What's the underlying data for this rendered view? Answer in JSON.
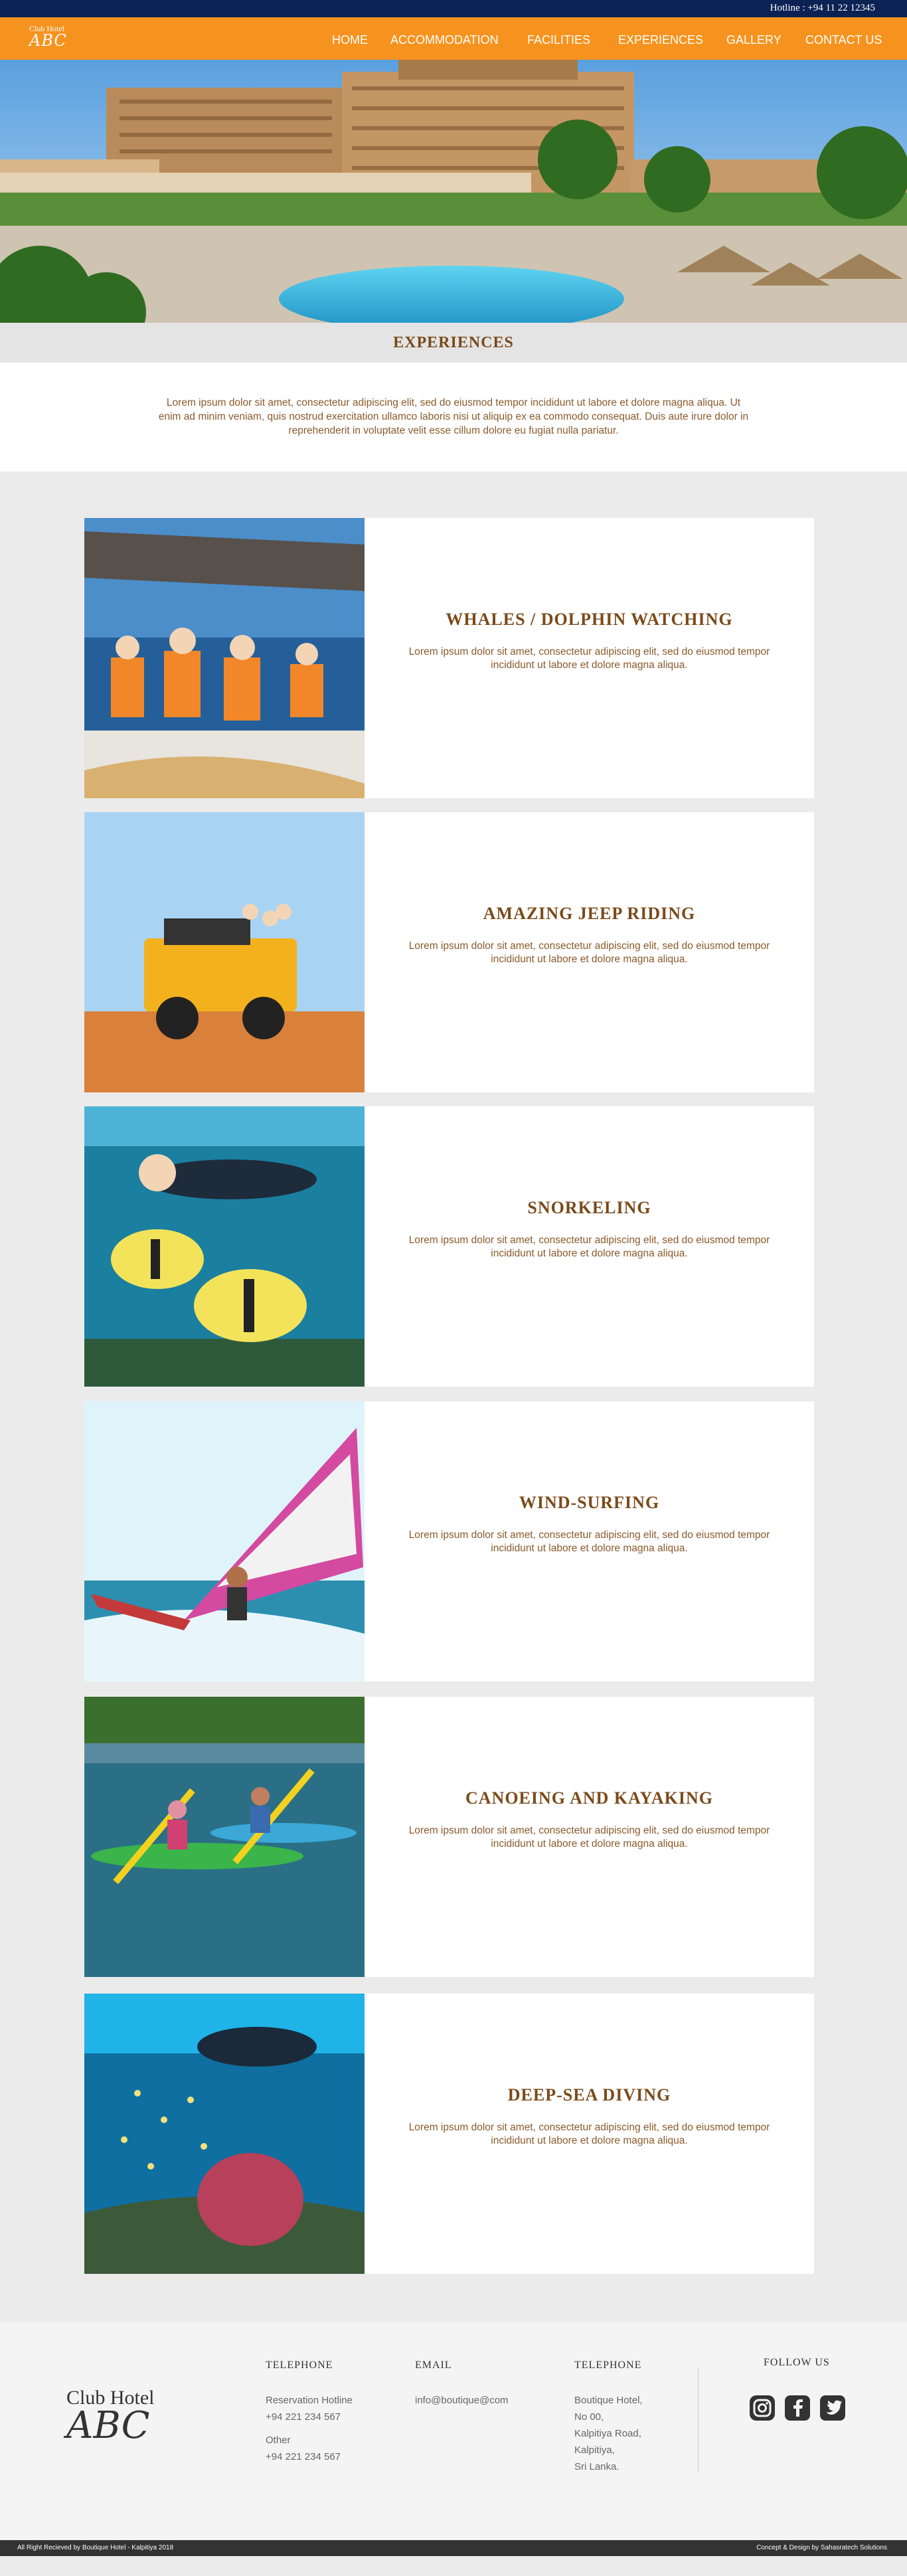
{
  "header": {
    "hotline": "Hotline : +94 11 22 12345",
    "logo_line1": "Club Hotel",
    "logo_line2": "ABC"
  },
  "nav": {
    "items": [
      {
        "label": "HOME",
        "active": false
      },
      {
        "label": "ACCOMMODATION",
        "active": false
      },
      {
        "label": "FACILITIES",
        "active": false
      },
      {
        "label": "EXPERIENCES",
        "active": true
      },
      {
        "label": "GALLERY",
        "active": false
      },
      {
        "label": "CONTACT US",
        "active": false
      }
    ]
  },
  "page": {
    "title": "EXPERIENCES",
    "intro": "Lorem ipsum dolor sit amet, consectetur adipiscing elit, sed do eiusmod tempor incididunt ut labore et dolore magna aliqua. Ut enim ad minim veniam, quis nostrud exercitation ullamco laboris nisi ut aliquip ex ea commodo consequat. Duis aute irure dolor in reprehenderit in voluptate velit esse cillum dolore eu fugiat nulla pariatur."
  },
  "experiences": [
    {
      "title": "WHALES / DOLPHIN WATCHING",
      "description": "Lorem ipsum dolor sit amet, consectetur adipiscing elit, sed do eiusmod tempor incididunt ut labore et dolore magna aliqua."
    },
    {
      "title": "AMAZING JEEP RIDING",
      "description": "Lorem ipsum dolor sit amet, consectetur adipiscing elit, sed do eiusmod tempor incididunt ut labore et dolore magna aliqua."
    },
    {
      "title": "SNORKELING",
      "description": "Lorem ipsum dolor sit amet, consectetur adipiscing elit, sed do eiusmod tempor incididunt ut labore et dolore magna aliqua."
    },
    {
      "title": "WIND-SURFING",
      "description": "Lorem ipsum dolor sit amet, consectetur adipiscing elit, sed do eiusmod tempor incididunt ut labore et dolore magna aliqua."
    },
    {
      "title": "CANOEING AND KAYAKING",
      "description": "Lorem ipsum dolor sit amet, consectetur adipiscing elit, sed do eiusmod tempor incididunt ut labore et dolore magna aliqua."
    },
    {
      "title": "DEEP-SEA DIVING",
      "description": "Lorem ipsum dolor sit amet, consectetur adipiscing elit, sed do eiusmod tempor incididunt ut labore et dolore magna aliqua."
    }
  ],
  "footer": {
    "logo_line1": "Club Hotel",
    "logo_line2": "ABC",
    "col1": {
      "heading": "TELEPHONE",
      "label1": "Reservation Hotline",
      "value1": "+94 221 234 567",
      "label2": "Other",
      "value2": "+94 221 234 567"
    },
    "col2": {
      "heading": "EMAIL",
      "email": "info@boutique@com"
    },
    "col3": {
      "heading": "TELEPHONE",
      "lines": [
        "Boutique Hotel,",
        "No 00,",
        "Kalpitiya Road,",
        "Kalpitiya,",
        "Sri Lanka."
      ]
    },
    "follow": "FOLLOW US",
    "social": [
      "instagram-icon",
      "facebook-icon",
      "twitter-icon"
    ]
  },
  "bottombar": {
    "copyright": "All Right Recieved by Boutique Hotel - Kalpitiya 2018",
    "credit": "Concept & Design by Sahasratech Solutions"
  },
  "colors": {
    "topbar": "#0c2254",
    "nav": "#f6931e",
    "accent_text": "#7a4a1a"
  }
}
